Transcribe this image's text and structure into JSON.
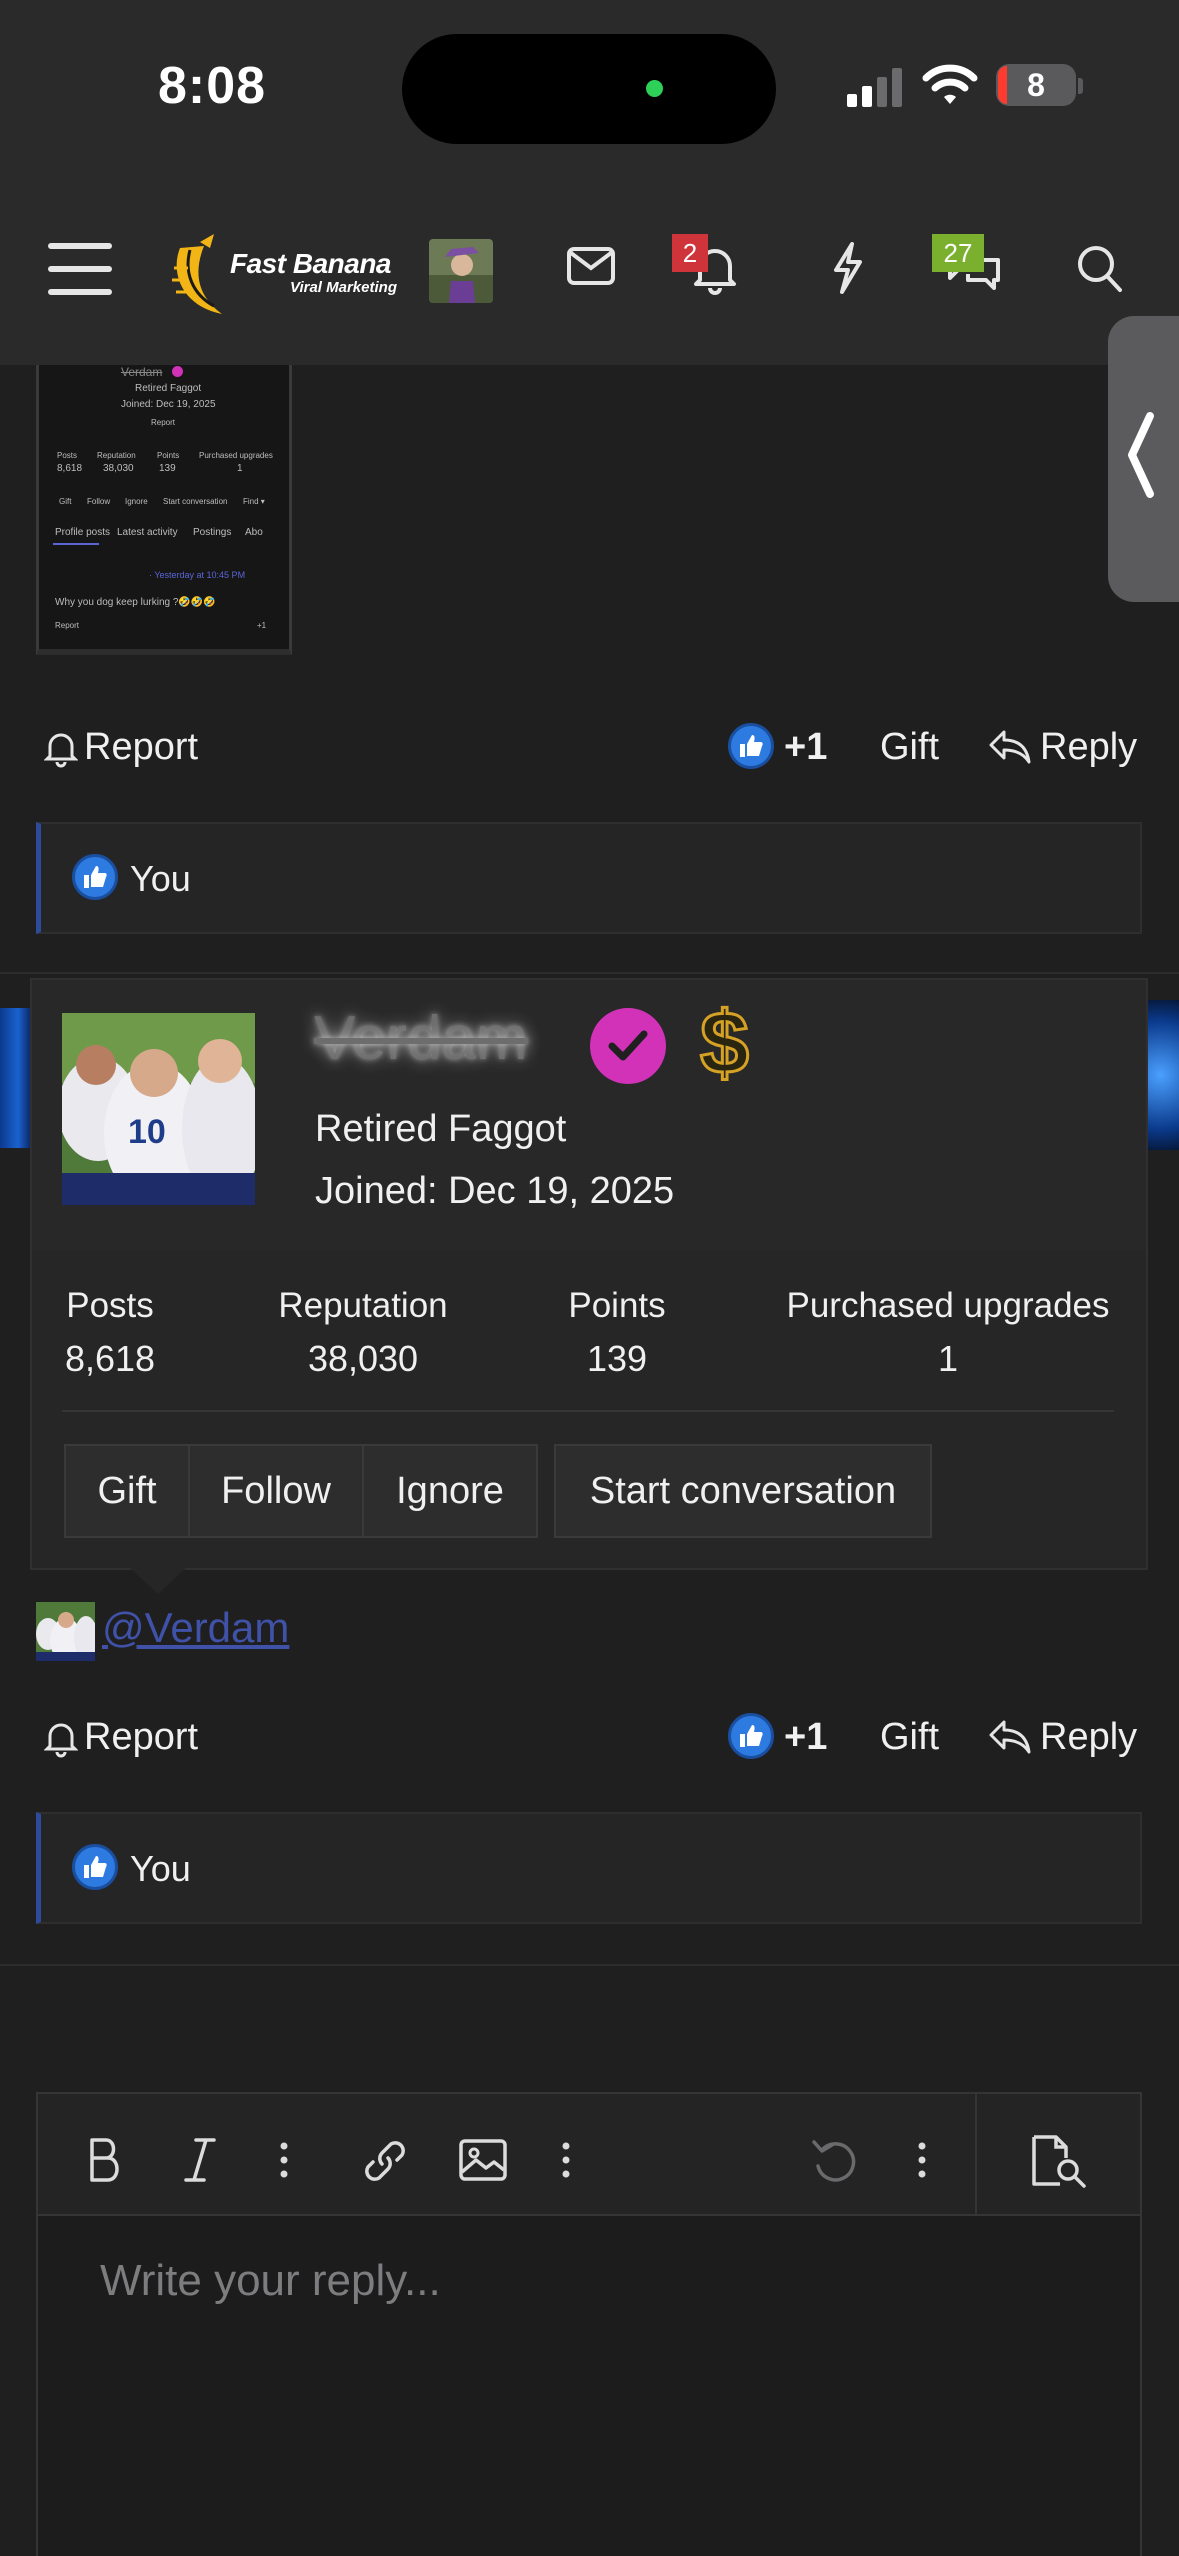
{
  "status": {
    "time": "8:08",
    "battery": "8"
  },
  "nav": {
    "logo_title": "Fast Banana",
    "logo_subtitle": "Viral Marketing",
    "notifications_badge": "2",
    "conversations_badge": "27"
  },
  "thumbnail": {
    "name": "Verdam",
    "title": "Retired Faggot",
    "joined": "Joined: Dec 19, 2025",
    "report": "Report",
    "stat_labels": [
      "Posts",
      "Reputation",
      "Points",
      "Purchased upgrades"
    ],
    "stat_values": [
      "8,618",
      "38,030",
      "139",
      "1"
    ],
    "buttons": [
      "Gift",
      "Follow",
      "Ignore",
      "Start conversation",
      "Find ▾"
    ],
    "tabs": [
      "Profile posts",
      "Latest activity",
      "Postings",
      "Abo"
    ],
    "post_meta": "· Yesterday at 10:45 PM",
    "post_text": "Why you dog keep lurking ?🤣🤣🤣",
    "post_report": "Report",
    "post_like": "+1"
  },
  "post1": {
    "report_label": "Report",
    "like_count": "+1",
    "gift_label": "Gift",
    "reply_label": "Reply",
    "likes_by": "You"
  },
  "profile_popup": {
    "username": "Verdam",
    "user_title": "Retired Faggot",
    "joined": "Joined: Dec 19, 2025",
    "stats": [
      {
        "label": "Posts",
        "value": "8,618"
      },
      {
        "label": "Reputation",
        "value": "38,030"
      },
      {
        "label": "Points",
        "value": "139"
      },
      {
        "label": "Purchased upgrades",
        "value": "1"
      }
    ],
    "buttons": {
      "gift": "Gift",
      "follow": "Follow",
      "ignore": "Ignore",
      "start_conversation": "Start conversation"
    },
    "badge_symbol": "$"
  },
  "post2": {
    "mention": "@Verdam",
    "report_label": "Report",
    "like_count": "+1",
    "gift_label": "Gift",
    "reply_label": "Reply",
    "likes_by": "You"
  },
  "editor": {
    "placeholder": "Write your reply..."
  },
  "colors": {
    "background": "#1f1f20",
    "header": "#2a2a2b",
    "like_blue": "#2d7be0",
    "verified_pink": "#d232b8",
    "mention_link": "#3f52a8",
    "alert_badge": "#d0343b",
    "conversation_badge": "#7ab02e",
    "likes_accent": "#2c4b9a"
  }
}
